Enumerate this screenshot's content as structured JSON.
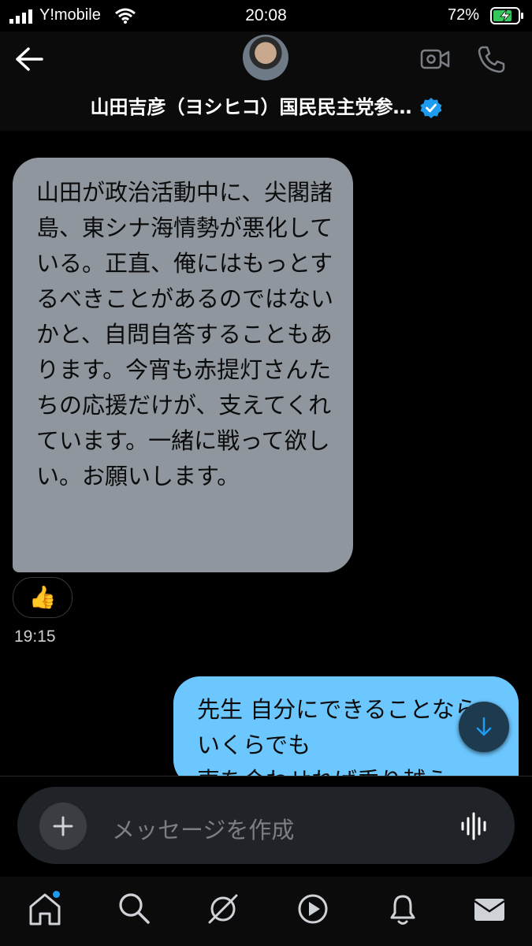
{
  "status_bar": {
    "carrier": "Y!mobile",
    "time": "20:08",
    "battery_percent": "72%"
  },
  "header": {
    "contact_name": "山田吉彦（ヨシヒコ）国民民主党参…",
    "verified": true
  },
  "messages": [
    {
      "direction": "incoming",
      "text": "山田が政治活動中に、尖閣諸島、東シナ海情勢が悪化している。正直、俺にはもっとするべきことがあるのではないかと、自問自答することもあります。今宵も赤提灯さんたちの応援だけが、支えてくれています。一緒に戦って欲しい。お願いします。",
      "reaction": "👍",
      "time": "19:15"
    },
    {
      "direction": "outgoing",
      "text": "先生 自分にできることならいくらでも\n声を合わせれば乗り越え"
    }
  ],
  "composer": {
    "placeholder": "メッセージを作成"
  },
  "tabs": [
    "home",
    "search",
    "grok",
    "video",
    "notifications",
    "messages"
  ],
  "colors": {
    "incoming_bubble": "#8f969e",
    "outgoing_bubble": "#6cc7ff",
    "accent": "#1d9bf0",
    "background": "#000000"
  }
}
